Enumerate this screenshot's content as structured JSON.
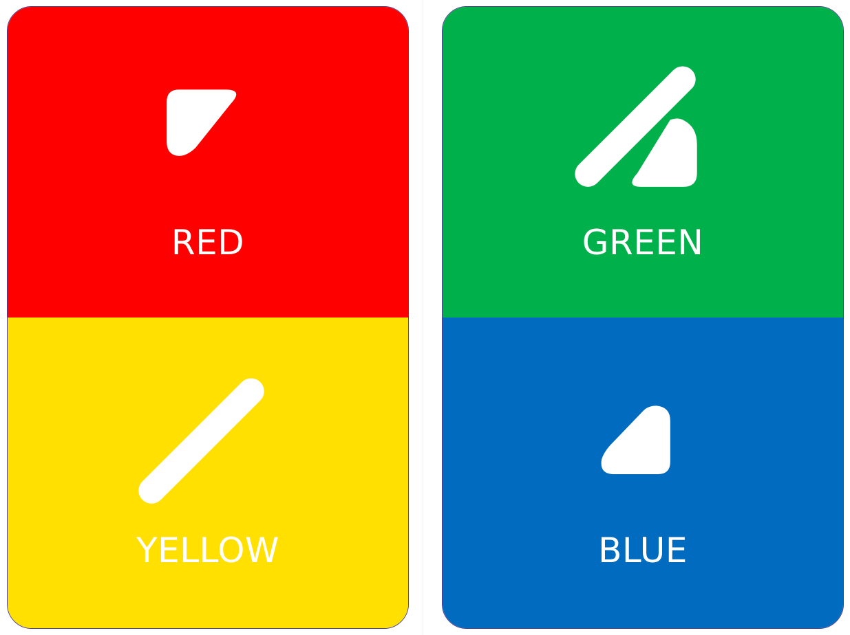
{
  "cards": [
    {
      "panels": [
        {
          "label": "RED",
          "color": "#ff0000",
          "icon": "corner-triangle-icon"
        },
        {
          "label": "YELLOW",
          "color": "#ffe000",
          "icon": "diagonal-bar-icon"
        }
      ]
    },
    {
      "panels": [
        {
          "label": "GREEN",
          "color": "#00b04a",
          "icon": "bar-and-triangle-icon"
        },
        {
          "label": "BLUE",
          "color": "#006bbf",
          "icon": "corner-triangle-icon"
        }
      ]
    }
  ]
}
